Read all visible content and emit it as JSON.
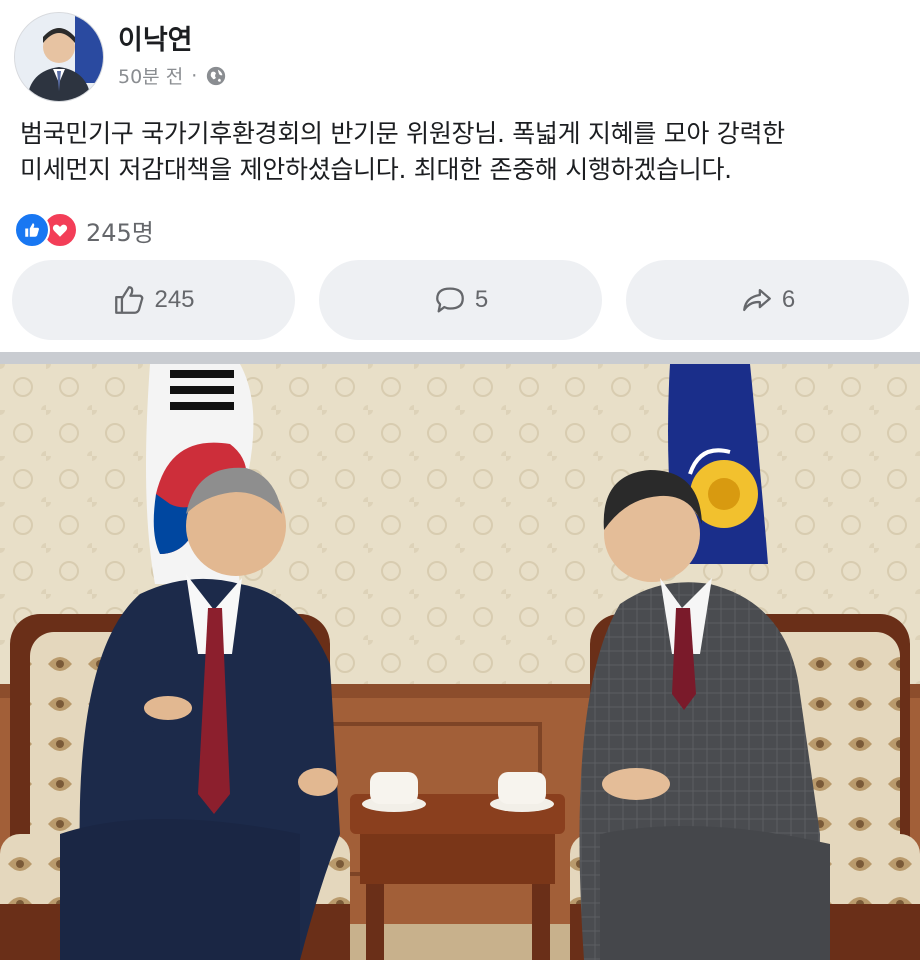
{
  "post": {
    "author": "이낙연",
    "time": "50분 전",
    "separator": "·",
    "privacy_icon": "globe-icon",
    "text": "범국민기구 국가기후환경회의 반기문 위원장님. 폭넓게 지혜를 모아 강력한\n미세먼지 저감대책을 제안하셨습니다. 최대한 존중해 시행하겠습니다."
  },
  "reactions": {
    "icons": [
      "like-icon",
      "love-icon"
    ],
    "count_label": "245명"
  },
  "actions": {
    "like_count": "245",
    "comment_count": "5",
    "share_count": "6"
  },
  "colors": {
    "like_blue": "#1877f2",
    "love_red": "#f33e58",
    "button_bg": "#eef0f3",
    "muted_text": "#65676b"
  }
}
